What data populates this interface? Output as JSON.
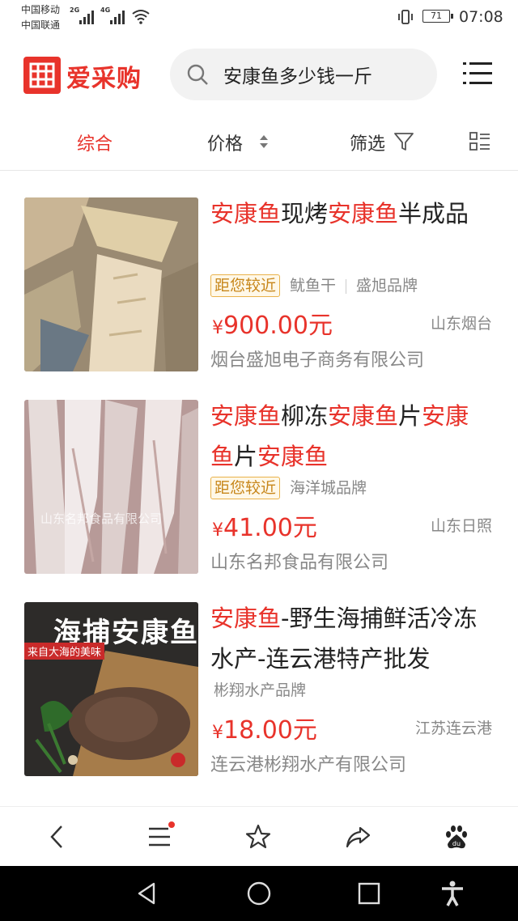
{
  "status": {
    "carrier1": "中国移动",
    "carrier2": "中国联通",
    "net1": "2G",
    "net2": "4G",
    "battery": "71",
    "time": "07:08"
  },
  "header": {
    "brand": "爱采购",
    "search_value": "安康鱼多少钱一斤"
  },
  "sortbar": {
    "tabs": [
      "综合",
      "价格",
      "筛选"
    ]
  },
  "products": [
    {
      "title_parts": [
        {
          "text": "安康鱼",
          "hl": true
        },
        {
          "text": "现烤",
          "hl": false
        },
        {
          "text": "安康鱼",
          "hl": true
        },
        {
          "text": "半成品",
          "hl": false
        }
      ],
      "tag_near": "距您较近",
      "tags": [
        "鱿鱼干",
        "盛旭品牌"
      ],
      "price_symbol": "¥",
      "price": "900.00元",
      "location": "山东烟台",
      "company": "烟台盛旭电子商务有限公司"
    },
    {
      "title_parts": [
        {
          "text": "安康鱼",
          "hl": true
        },
        {
          "text": "柳冻",
          "hl": false
        },
        {
          "text": "安康鱼",
          "hl": true
        },
        {
          "text": "片",
          "hl": false
        },
        {
          "text": "安康鱼",
          "hl": true
        },
        {
          "text": "片",
          "hl": false
        },
        {
          "text": "安康鱼",
          "hl": true
        }
      ],
      "tag_near": "距您较近",
      "tags": [
        "海洋城品牌"
      ],
      "price_symbol": "¥",
      "price": "41.00元",
      "location": "山东日照",
      "company": "山东名邦食品有限公司",
      "watermark": "山东名邦食品有限公司"
    },
    {
      "title_parts": [
        {
          "text": "安康鱼",
          "hl": true
        },
        {
          "text": "-野生海捕鲜活冷冻水产-连云港特产批发",
          "hl": false
        }
      ],
      "tags": [
        "彬翔水产品牌"
      ],
      "price_symbol": "¥",
      "price": "18.00元",
      "location": "江苏连云港",
      "company": "连云港彬翔水产有限公司",
      "image_text1": "海捕安康鱼",
      "image_text2": "来自大海的美味"
    }
  ],
  "colors": {
    "accent": "#e8332b",
    "tag_border": "#e9b24a",
    "muted": "#888888"
  },
  "icons": {
    "toolbar": [
      "back-icon",
      "menu-icon",
      "star-icon",
      "share-icon",
      "baidu-icon"
    ],
    "navbar": [
      "nav-back-icon",
      "nav-home-icon",
      "nav-recent-icon",
      "accessibility-icon"
    ]
  }
}
